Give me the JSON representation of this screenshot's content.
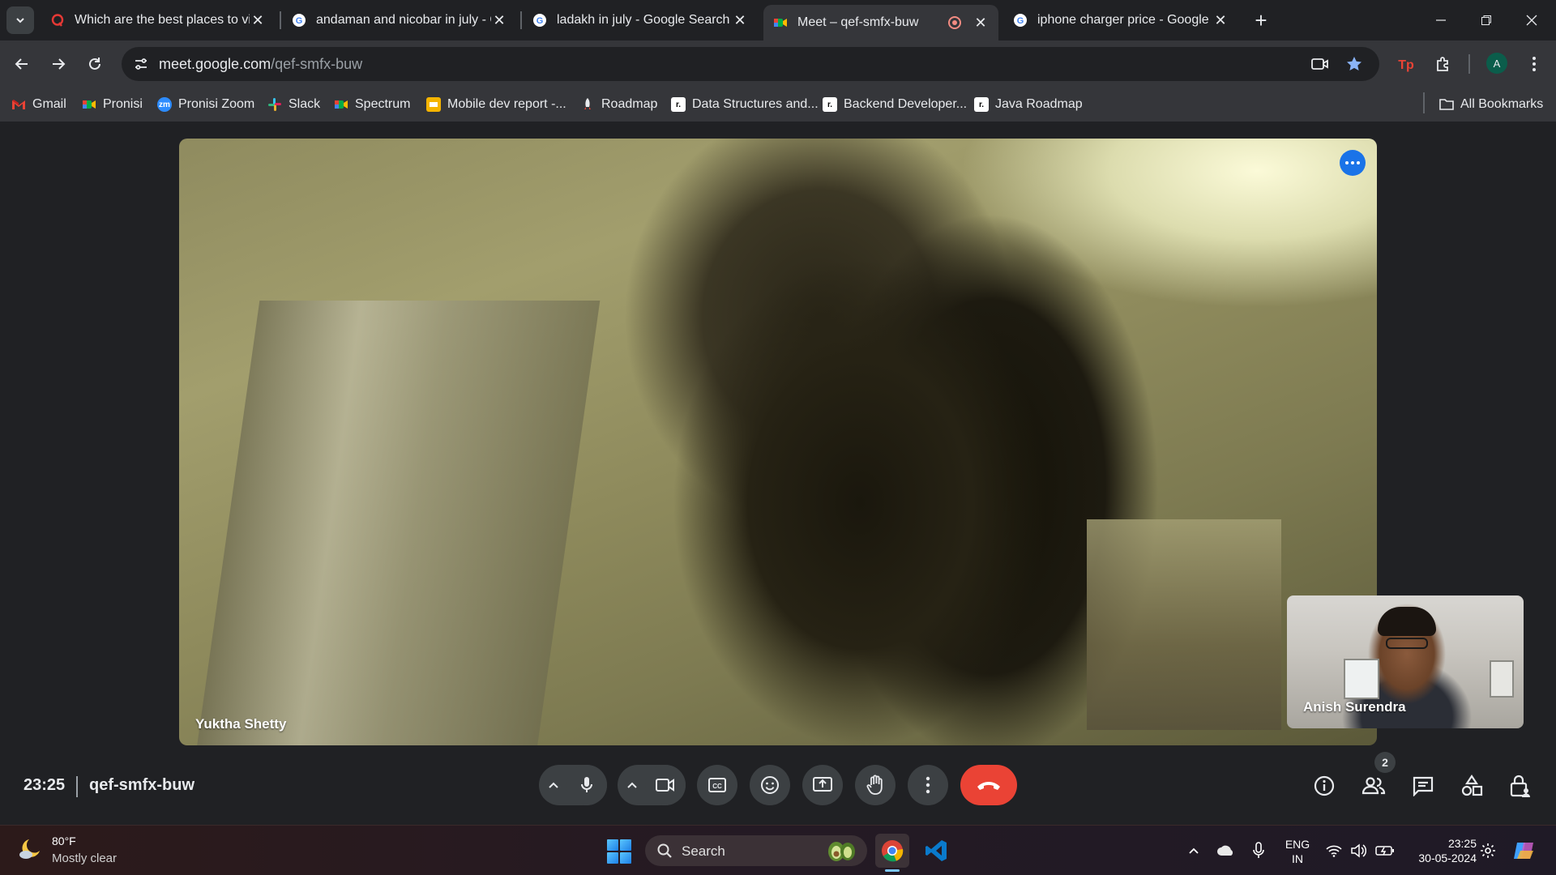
{
  "browser": {
    "tabs": [
      {
        "title": "Which are the best places to vis",
        "favicon": "quora-icon",
        "active": false
      },
      {
        "title": "andaman and nicobar in july - G",
        "favicon": "google-icon",
        "active": false
      },
      {
        "title": "ladakh in july - Google Search",
        "favicon": "google-icon",
        "active": false
      },
      {
        "title": "Meet – qef-smfx-buw",
        "favicon": "meet-icon",
        "active": true,
        "recording": true
      },
      {
        "title": "iphone charger price - Google S",
        "favicon": "google-icon",
        "active": false
      }
    ],
    "url_host": "meet.google.com",
    "url_path": "/qef-smfx-buw",
    "profile_initial": "A",
    "bookmarks": [
      {
        "label": "Gmail",
        "icon": "gmail-icon"
      },
      {
        "label": "Pronisi",
        "icon": "meet-icon"
      },
      {
        "label": "Pronisi Zoom",
        "icon": "zoom-icon"
      },
      {
        "label": "Slack",
        "icon": "slack-icon"
      },
      {
        "label": "Spectrum",
        "icon": "meet-icon"
      },
      {
        "label": "Mobile dev report -...",
        "icon": "slides-icon"
      },
      {
        "label": "Roadmap",
        "icon": "rocket-icon"
      },
      {
        "label": "Data Structures and...",
        "icon": "roadmap-icon"
      },
      {
        "label": "Backend Developer...",
        "icon": "roadmap-icon"
      },
      {
        "label": "Java Roadmap",
        "icon": "roadmap-icon"
      }
    ],
    "all_bookmarks": "All Bookmarks"
  },
  "meet": {
    "main_participant": "Yuktha Shetty",
    "self_participant": "Anish Surendra",
    "time": "23:25",
    "meeting_code": "qef-smfx-buw",
    "people_count": "2"
  },
  "taskbar": {
    "weather_temp": "80°F",
    "weather_desc": "Mostly clear",
    "search_placeholder": "Search",
    "lang_line1": "ENG",
    "lang_line2": "IN",
    "clock_time": "23:25",
    "clock_date": "30-05-2024"
  },
  "colors": {
    "accent_blue": "#1a73e8",
    "end_call_red": "#ea4335",
    "meet_bg": "#202124"
  }
}
